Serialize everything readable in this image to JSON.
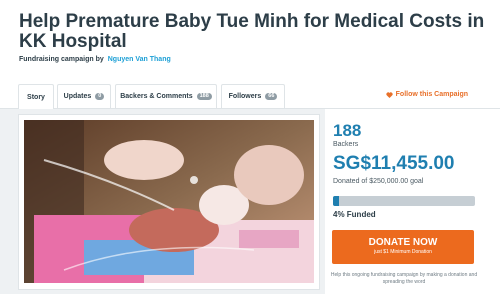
{
  "campaign": {
    "title": "Help Premature Baby Tue Minh for Medical Costs in KK Hospital",
    "byline_prefix": "Fundraising campaign by",
    "author": "Nguyen Van Thang"
  },
  "tabs": [
    {
      "label": "Story",
      "count": null
    },
    {
      "label": "Updates",
      "count": "0"
    },
    {
      "label": "Backers & Comments",
      "count": "188"
    },
    {
      "label": "Followers",
      "count": "66"
    }
  ],
  "follow": {
    "label": "Follow this Campaign",
    "icon": "heart-icon"
  },
  "stats": {
    "backers": "188",
    "backers_label": "Backers",
    "raised": "SG$11,455.00",
    "goal_text": "Donated of $250,000.00 goal",
    "funded_percent": 4,
    "funded_label": "4% Funded"
  },
  "donate": {
    "label": "DONATE NOW",
    "sublabel": "just $1 Minimum Donation"
  },
  "footnote": "Help this ongoing fundraising campaign by making a donation and spreading the word",
  "colors": {
    "accent_blue": "#1f7fb0",
    "donate_orange": "#ec6a1e",
    "link_blue": "#1ea0d6"
  }
}
